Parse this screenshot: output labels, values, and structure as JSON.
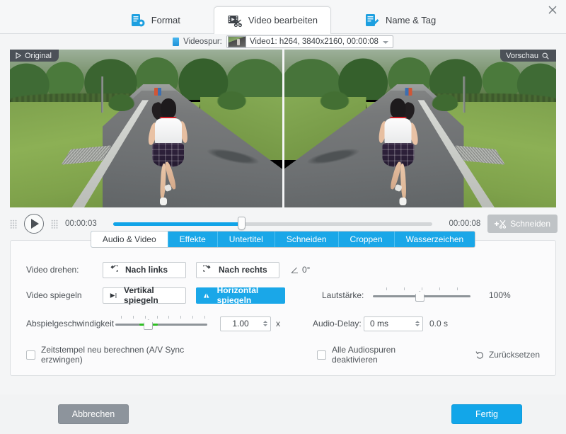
{
  "window": {
    "close_label": "✕"
  },
  "tabs": [
    {
      "label": "Format",
      "icon": "format-gear-icon",
      "active": false
    },
    {
      "label": "Video bearbeiten",
      "icon": "film-scissors-icon",
      "active": true
    },
    {
      "label": "Name & Tag",
      "icon": "pencil-document-icon",
      "active": false
    }
  ],
  "track": {
    "label": "Videospur:",
    "selected": "Video1: h264, 3840x2160, 00:00:08",
    "icon": "video-track-icon",
    "caret": "chevron-down-icon"
  },
  "preview": {
    "left_badge": "Original",
    "left_badge_icon": "play-triangle-icon",
    "right_badge": "Vorschau",
    "right_badge_icon": "magnifier-icon"
  },
  "playback": {
    "play_icon": "play-icon",
    "current_time": "00:00:03",
    "total_time": "00:00:08",
    "progress_percent": 40,
    "cut_label": "Schneiden",
    "cut_icon": "plus-scissors-icon"
  },
  "subtabs": [
    {
      "label": "Audio & Video",
      "active": true
    },
    {
      "label": "Effekte",
      "active": false
    },
    {
      "label": "Untertitel",
      "active": false
    },
    {
      "label": "Schneiden",
      "active": false
    },
    {
      "label": "Croppen",
      "active": false
    },
    {
      "label": "Wasserzeichen",
      "active": false
    }
  ],
  "editor": {
    "rotate_label": "Video drehen:",
    "rotate_left": "Nach links",
    "rotate_left_icon": "rotate-ccw-icon",
    "rotate_right": "Nach rechts",
    "rotate_right_icon": "rotate-cw-icon",
    "rotate_angle": "0°",
    "rotate_angle_icon": "angle-icon",
    "flip_label": "Video spiegeln",
    "flip_vertical": "Vertikal spiegeln",
    "flip_vertical_icon": "flip-vertical-icon",
    "flip_horizontal": "Horizontal spiegeln",
    "flip_horizontal_icon": "flip-horizontal-icon",
    "flip_horizontal_active": true,
    "speed_label": "Abspielgeschwindigkeit",
    "speed_value": "1.00",
    "speed_unit": "x",
    "speed_percent": 36,
    "speed_green_from": 26,
    "speed_green_to": 46,
    "volume_label": "Lautstärke:",
    "volume_value": "100%",
    "volume_percent": 48,
    "audio_delay_label": "Audio-Delay:",
    "audio_delay_value": "0 ms",
    "audio_delay_seconds": "0.0 s",
    "recalc_timestamps": "Zeitstempel neu berechnen (A/V Sync erzwingen)",
    "recalc_timestamps_checked": false,
    "disable_audio_tracks": "Alle Audiospuren deaktivieren",
    "disable_audio_tracks_checked": false,
    "reset_label": "Zurücksetzen",
    "reset_icon": "reset-icon"
  },
  "footer": {
    "cancel": "Abbrechen",
    "done": "Fertig"
  },
  "colors": {
    "accent": "#1aa7e8",
    "progress": "#11a4e8",
    "speed_green": "#2fc023",
    "cancel_grey": "#8d949c"
  }
}
